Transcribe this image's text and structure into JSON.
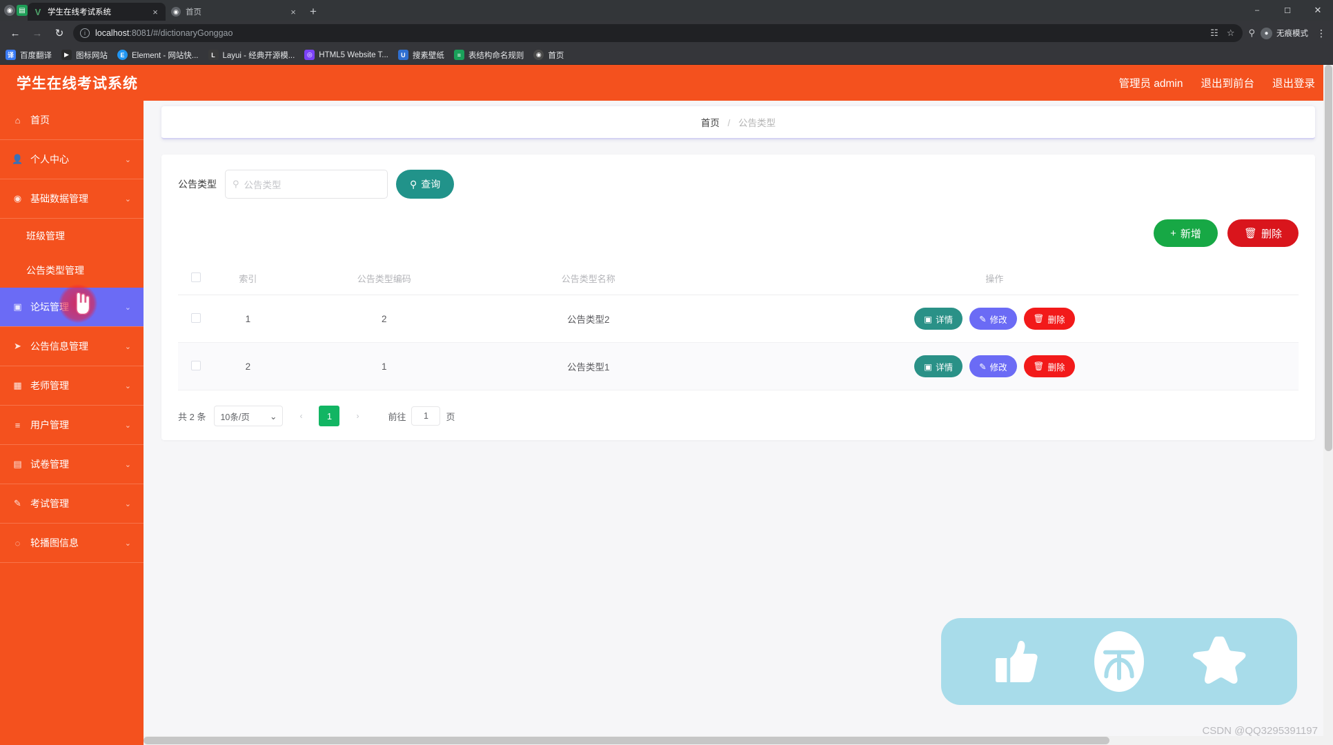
{
  "browser": {
    "tabs": [
      {
        "title": "学生在线考试系统",
        "favicon": "v-logo-icon",
        "active": true,
        "close_label": "×"
      },
      {
        "title": "首页",
        "favicon": "globe-icon",
        "active": false,
        "close_label": "×"
      }
    ],
    "newtab_label": "+",
    "window_controls": {
      "minimize": "–",
      "maximize": "☐",
      "close": "✕"
    },
    "nav": {
      "back": "←",
      "forward": "→",
      "reload": "↻"
    },
    "omnibox": {
      "info_icon": "ⓘ",
      "url_host": "localhost",
      "url_path": ":8081/#/dictionaryGonggao",
      "translate_icon": "translate-icon",
      "star_icon": "☆",
      "key_icon": "key-icon"
    },
    "profile": {
      "label": "无痕模式",
      "avatar_glyph": "●"
    },
    "menu_glyph": "⋮",
    "bookmarks": [
      {
        "label": "百度翻译",
        "ico": "译",
        "color": "#3b7cf5"
      },
      {
        "label": "图标网站",
        "ico": "▶",
        "color": "#2b2b2b"
      },
      {
        "label": "Element - 网站快...",
        "ico": "E",
        "color": "#2196f3"
      },
      {
        "label": "Layui - 经典开源模...",
        "ico": "L",
        "color": "#3a3a3a"
      },
      {
        "label": "HTML5 Website T...",
        "ico": "◎",
        "color": "#7b42f6"
      },
      {
        "label": "搜素壁纸",
        "ico": "U",
        "color": "#2f6fd0"
      },
      {
        "label": "表结构命名规则",
        "ico": "≡",
        "color": "#1aa15a"
      },
      {
        "label": "首页",
        "ico": "◉",
        "color": "#4a4a4a"
      }
    ]
  },
  "app": {
    "title": "学生在线考试系统",
    "header_links": [
      "管理员 admin",
      "退出到前台",
      "退出登录"
    ],
    "sidebar": [
      {
        "label": "首页",
        "icon": "home-icon",
        "glyph": "⌂",
        "sub": false,
        "active": false,
        "arrow": ""
      },
      {
        "label": "个人中心",
        "icon": "user-icon",
        "glyph": "●",
        "sub": false,
        "active": false,
        "arrow": "⌄"
      },
      {
        "label": "基础数据管理",
        "icon": "database-icon",
        "glyph": "⊙",
        "sub": false,
        "active": false,
        "arrow": "⌄"
      },
      {
        "label": "班级管理",
        "icon": "",
        "glyph": "",
        "sub": true,
        "active": false,
        "arrow": ""
      },
      {
        "label": "公告类型管理",
        "icon": "",
        "glyph": "",
        "sub": true,
        "active": false,
        "arrow": ""
      },
      {
        "label": "论坛管理",
        "icon": "forum-icon",
        "glyph": "▣",
        "sub": false,
        "active": true,
        "arrow": "⌄"
      },
      {
        "label": "公告信息管理",
        "icon": "megaphone-icon",
        "glyph": "➤",
        "sub": false,
        "active": false,
        "arrow": "⌄"
      },
      {
        "label": "老师管理",
        "icon": "teacher-icon",
        "glyph": "▧",
        "sub": false,
        "active": false,
        "arrow": "⌄"
      },
      {
        "label": "用户管理",
        "icon": "users-icon",
        "glyph": "≡",
        "sub": false,
        "active": false,
        "arrow": "⌄"
      },
      {
        "label": "试卷管理",
        "icon": "paper-icon",
        "glyph": "▤",
        "sub": false,
        "active": false,
        "arrow": "⌄"
      },
      {
        "label": "考试管理",
        "icon": "exam-icon",
        "glyph": "✎",
        "sub": false,
        "active": false,
        "arrow": "⌄"
      },
      {
        "label": "轮播图信息",
        "icon": "carousel-icon",
        "glyph": "◴",
        "sub": false,
        "active": false,
        "arrow": "⌄"
      }
    ],
    "breadcrumb": {
      "home": "首页",
      "separator": "/",
      "current": "公告类型"
    },
    "filter": {
      "label": "公告类型",
      "placeholder": "公告类型",
      "value": "",
      "search_icon": "search-icon",
      "query_button": "查询"
    },
    "operations": {
      "add_label": "新增",
      "add_icon": "plus-icon",
      "delete_label": "删除",
      "delete_icon": "trash-icon"
    },
    "table": {
      "columns": [
        "索引",
        "公告类型编码",
        "公告类型名称",
        "操作"
      ],
      "rows": [
        {
          "index": "1",
          "code": "2",
          "name": "公告类型2"
        },
        {
          "index": "2",
          "code": "1",
          "name": "公告类型1"
        }
      ],
      "row_actions": {
        "detail": "详情",
        "detail_icon": "document-icon",
        "edit": "修改",
        "edit_icon": "pencil-icon",
        "delete": "删除",
        "delete_icon": "trash-icon"
      }
    },
    "pagination": {
      "total_text": "共 2 条",
      "page_size": "10条/页",
      "prev": "‹",
      "current_page": "1",
      "next": "›",
      "jump_prefix": "前往",
      "jump_value": "1",
      "jump_suffix": "页"
    },
    "float_widget": {
      "items": [
        {
          "name": "thumbs-up-icon"
        },
        {
          "name": "umbrella-icon"
        },
        {
          "name": "star-icon"
        }
      ]
    },
    "watermark": "CSDN @QQ3295391197"
  },
  "colors": {
    "brand_orange": "#f4511e",
    "active_blue": "#6b6bf5",
    "teal": "#21938a",
    "green": "#17a845",
    "red": "#d9151c",
    "pager_green": "#12b563",
    "widget_blue": "#a8dcea"
  }
}
